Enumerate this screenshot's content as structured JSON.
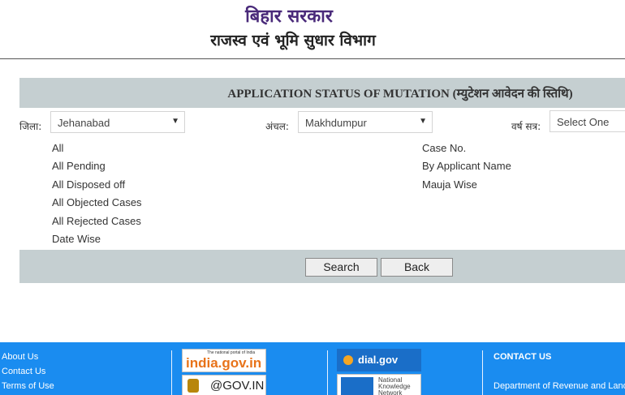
{
  "header": {
    "line1": "बिहार सरकार",
    "line2": "राजस्व एवं भूमि सुधार विभाग"
  },
  "form": {
    "title": "APPLICATION STATUS OF MUTATION (म्युटेशन आवेदन की स्तिथि)",
    "district_label": "जिला:",
    "district_value": "Jehanabad",
    "circle_label": "अंचल:",
    "circle_value": "Makhdumpur",
    "year_label": "वर्ष सत्र:",
    "year_value": "Select One",
    "status_options": [
      "All",
      "All Pending",
      "All Disposed off",
      "All Objected Cases",
      "All Rejected Cases",
      "Date Wise"
    ],
    "search_options": [
      "Case No.",
      "By Applicant Name",
      "Mauja Wise"
    ],
    "search_button": "Search",
    "back_button": "Back"
  },
  "footer": {
    "links": [
      "About Us",
      "Contact Us",
      "Terms of Use"
    ],
    "logos": {
      "india_gov_small": "The national portal of India",
      "india_gov": "india.gov.in",
      "gov_in": "@GOV.IN",
      "dial_gov": "dial.gov",
      "nkn": "National Knowledge Network"
    },
    "contact_title": "CONTACT US",
    "contact_line": "Department of Revenue and Land"
  },
  "colors": {
    "title_bar": "#c5cfd1",
    "footer": "#1a8cf0",
    "header_text": "#4a2a7a"
  }
}
